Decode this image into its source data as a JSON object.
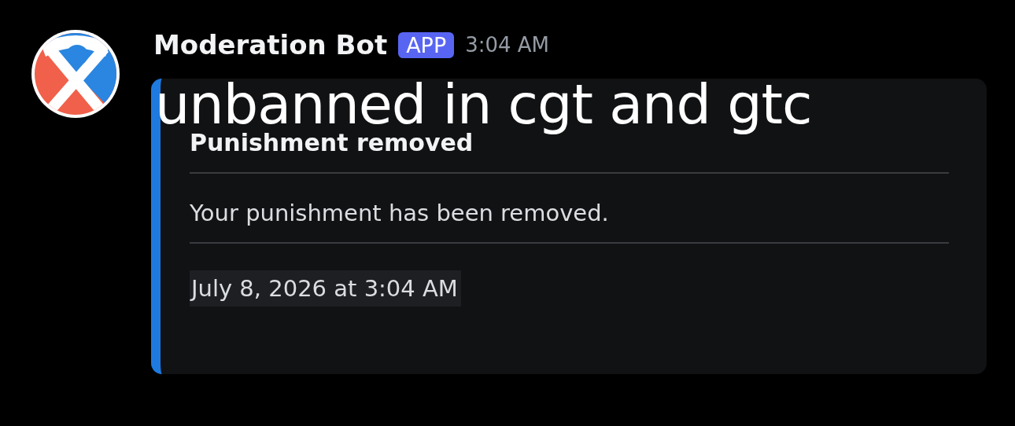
{
  "message": {
    "author": "Moderation Bot",
    "badge": "APP",
    "time": "3:04 AM"
  },
  "caption": "unbanned in cgt and gtc",
  "embed": {
    "color": "#1f7ae0",
    "title": "Punishment removed",
    "description": "Your punishment has been removed.",
    "footer": "July 8, 2026 at 3:04 AM"
  }
}
